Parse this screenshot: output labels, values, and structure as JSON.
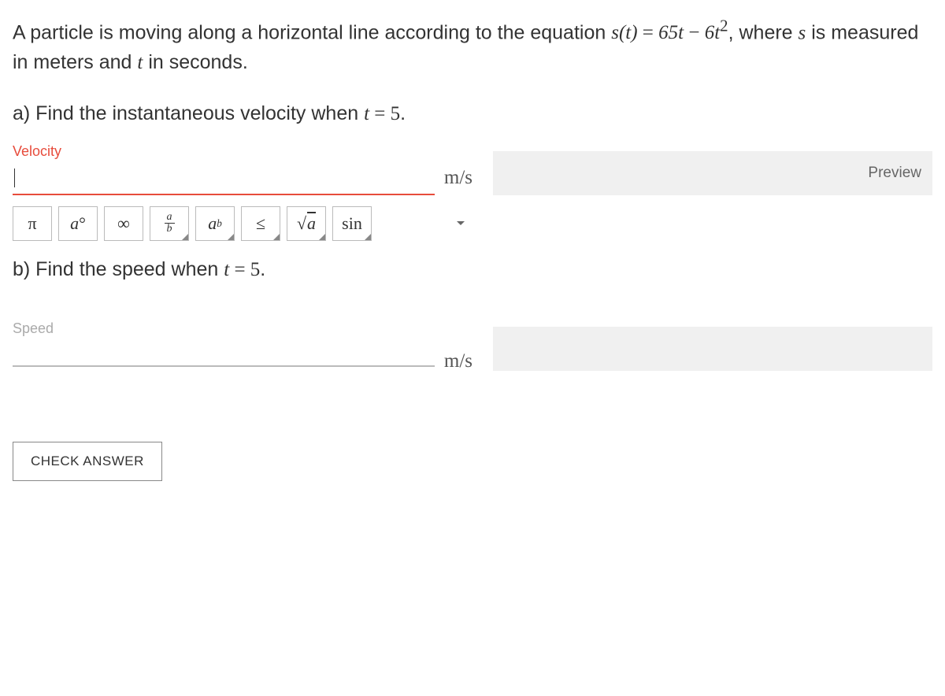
{
  "problem": {
    "text_prefix": "A particle is moving along a horizontal line according to the equation ",
    "equation": "s(t) = 65t − 6t²",
    "text_suffix_1": ", where ",
    "var_s": "s",
    "text_suffix_2": " is measured in meters and ",
    "var_t": "t",
    "text_suffix_3": " in seconds."
  },
  "part_a": {
    "label_prefix": "a) Find the instantaneous velocity when ",
    "label_eq": "t = 5",
    "label_suffix": ".",
    "field_label": "Velocity",
    "unit": "m/s",
    "value": "",
    "preview": "Preview"
  },
  "toolbar": {
    "pi": "π",
    "degree": "a°",
    "infinity": "∞",
    "fraction_num": "a",
    "fraction_den": "b",
    "power_base": "a",
    "power_exp": "b",
    "leq": "≤",
    "sqrt": "a",
    "sin": "sin"
  },
  "part_b": {
    "label_prefix": "b) Find the speed when ",
    "label_eq": "t = 5",
    "label_suffix": ".",
    "field_label": "Speed",
    "unit": "m/s",
    "value": ""
  },
  "check_button": "CHECK ANSWER"
}
